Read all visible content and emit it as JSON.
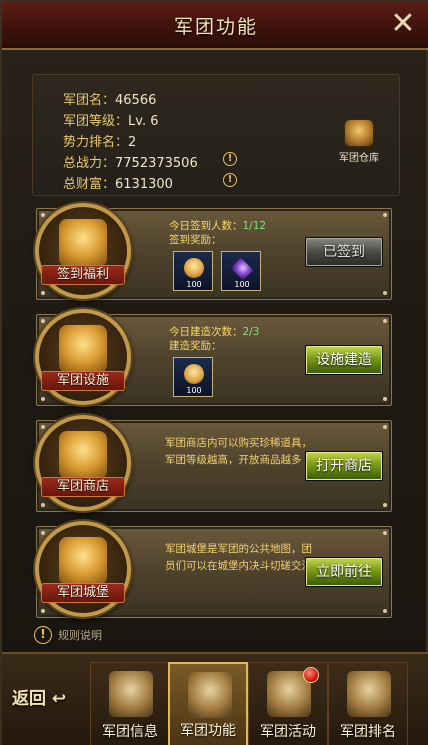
{
  "window": {
    "title": "军团功能",
    "close_symbol": "✕"
  },
  "legion_info": {
    "name_label": "军团名：",
    "name_value": "46566",
    "level_label": "军团等级：",
    "level_value": "Lv. 6",
    "rank_label": "势力排名：",
    "rank_value": "2",
    "power_label": "总战力：",
    "power_value": "7752373506",
    "wealth_label": "总财富：",
    "wealth_value": "6131300",
    "warehouse_label": "军团仓库",
    "warn_symbol": "!"
  },
  "signin": {
    "emblem_label": "签到福利",
    "count_label": "今日签到人数：",
    "count_value": "1/12",
    "reward_label": "签到奖励：",
    "reward1_num": "100",
    "reward2_num": "100",
    "button_label": "已签到"
  },
  "facility": {
    "emblem_label": "军团设施",
    "count_label": "今日建造次数：",
    "count_value": "2/3",
    "reward_label": "建造奖励：",
    "reward1_num": "100",
    "button_label": "设施建造"
  },
  "shop": {
    "emblem_label": "军团商店",
    "desc": "军团商店内可以购买珍稀道具，军团等级越高，开放商品越多",
    "button_label": "打开商店"
  },
  "castle": {
    "emblem_label": "军团城堡",
    "desc": "军团城堡是军团的公共地图，团员们可以在城堡内决斗切磋交流",
    "button_label": "立即前往"
  },
  "rules_label": "规则说明",
  "bottom_nav": {
    "back_label": "返回",
    "tabs": [
      {
        "label": "军团信息"
      },
      {
        "label": "军团功能"
      },
      {
        "label": "军团活动"
      },
      {
        "label": "军团排名"
      }
    ]
  }
}
